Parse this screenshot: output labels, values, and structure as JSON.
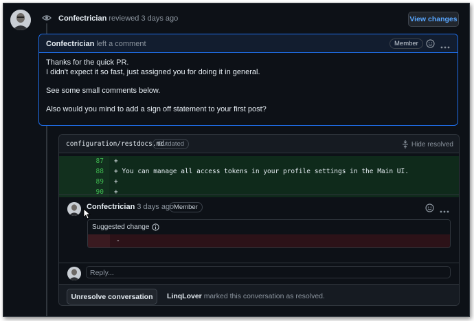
{
  "review_header": {
    "author": "Confectrician",
    "action": "reviewed",
    "time": "3 days ago",
    "view_changes_label": "View changes"
  },
  "comment": {
    "author": "Confectrician",
    "action": "left a comment",
    "role_badge": "Member",
    "body": [
      "Thanks for the quick PR.",
      "I didn't expect it so fast, just assigned you for doing it in general.",
      "See some small comments below.",
      "Also would you mind to add a sign off statement to your first post?"
    ]
  },
  "file_thread": {
    "path": "configuration/restdocs.md",
    "status_badge": "Outdated",
    "hide_resolved_label": "Hide resolved",
    "diff_lines": [
      {
        "num": "87",
        "code": "+"
      },
      {
        "num": "88",
        "code": "+ You can manage all access tokens in your profile settings in the Main UI."
      },
      {
        "num": "89",
        "code": "+"
      },
      {
        "num": "90",
        "code": "+"
      }
    ],
    "review_comment": {
      "author": "Confectrician",
      "time": "3 days ago",
      "role_badge": "Member",
      "suggested_change_label": "Suggested change",
      "suggestion_line": "-"
    },
    "reply_placeholder": "Reply...",
    "unresolve_label": "Unresolve conversation",
    "resolved_by": "LinqLover",
    "resolved_text": "marked this conversation as resolved."
  },
  "icons": {
    "eye": "eye-icon",
    "smiley": "smiley-icon",
    "kebab": "kebab-menu-icon",
    "unfold": "unfold-icon",
    "info": "info-icon",
    "cursor": "mouse-cursor-icon"
  },
  "colors": {
    "background": "#0d1117",
    "accent_border": "#1f6feb",
    "link_blue": "#58a6ff",
    "diff_added": "#0f2a1b",
    "diff_removed": "#2c1218"
  }
}
